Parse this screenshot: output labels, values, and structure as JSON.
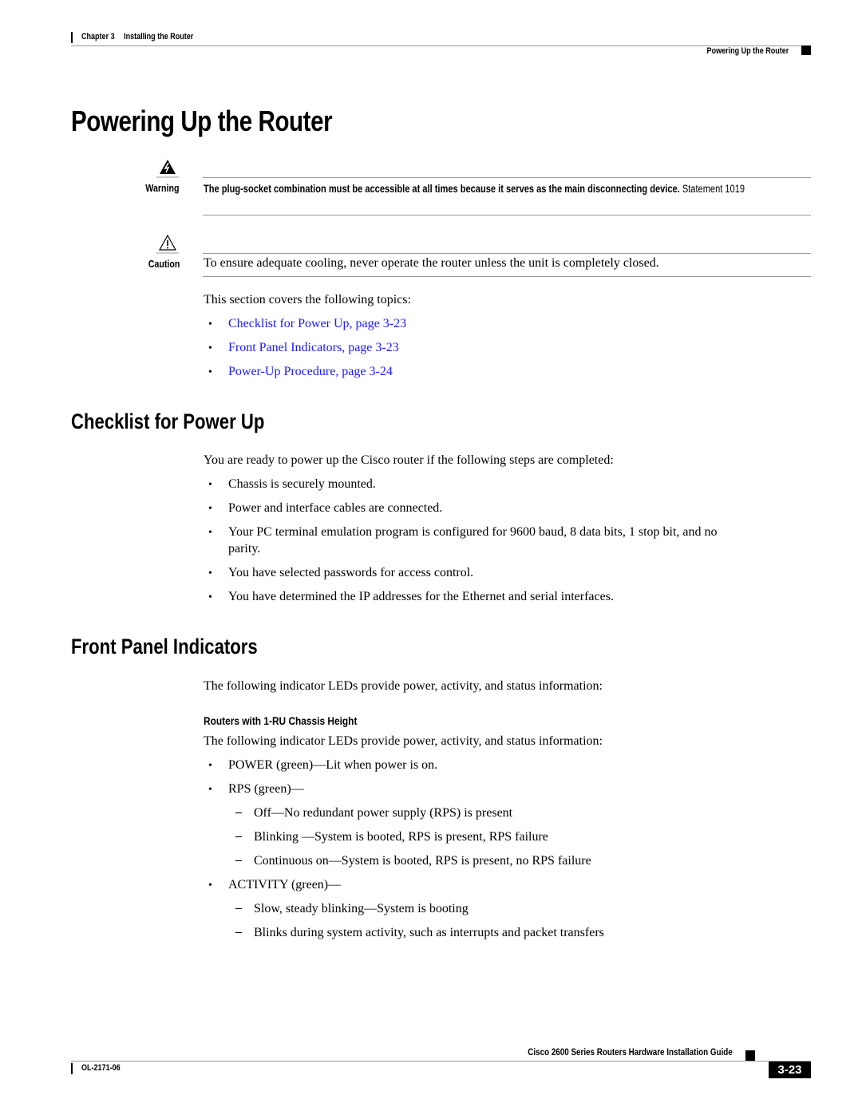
{
  "header": {
    "chapter": "Chapter 3",
    "chapter_title": "Installing the Router",
    "section": "Powering Up the Router"
  },
  "title": "Powering Up the Router",
  "warning": {
    "label": "Warning",
    "icon": "warning-lightning-icon",
    "bold_text": "The plug-socket combination must be accessible at all times because it serves as the main disconnecting device.",
    "statement": "Statement 1019"
  },
  "caution": {
    "label": "Caution",
    "icon": "caution-exclamation-icon",
    "text": "To ensure adequate cooling, never operate the router unless the unit is completely closed."
  },
  "intro": {
    "text": "This section covers the following topics:",
    "links": [
      "Checklist for Power Up, page 3-23",
      "Front Panel Indicators, page 3-23",
      "Power-Up Procedure, page 3-24"
    ],
    "link_color": "#1a1aff"
  },
  "checklist": {
    "heading": "Checklist for Power Up",
    "intro": "You are ready to power up the Cisco router if the following steps are completed:",
    "items": [
      "Chassis is securely mounted.",
      "Power and interface cables are connected.",
      "Your PC terminal emulation program is configured for 9600 baud, 8 data bits, 1 stop bit, and no",
      "parity.",
      "You have selected passwords for access control.",
      "You have determined the IP addresses for the Ethernet and serial interfaces."
    ]
  },
  "front_panel": {
    "heading": "Front Panel Indicators",
    "intro": "The following indicator LEDs provide power, activity, and status information:",
    "subheading": "Routers with 1-RU Chassis Height",
    "sub_intro": "The following indicator LEDs provide power, activity, and status information:",
    "power": "POWER (green)—Lit when power is on.",
    "rps": "RPS (green)—",
    "rps_items": [
      "Off—No redundant power supply (RPS) is present",
      "Blinking —System is booted, RPS is present, RPS failure",
      "Continuous on—System is booted, RPS is present, no RPS failure"
    ],
    "activity": "ACTIVITY (green)—",
    "activity_items": [
      "Slow, steady blinking—System is booting",
      "Blinks during system activity, such as interrupts and packet transfers"
    ]
  },
  "footer": {
    "guide_title": "Cisco 2600 Series Routers Hardware Installation Guide",
    "doc_number": "OL-2171-06",
    "page_number": "3-23"
  }
}
